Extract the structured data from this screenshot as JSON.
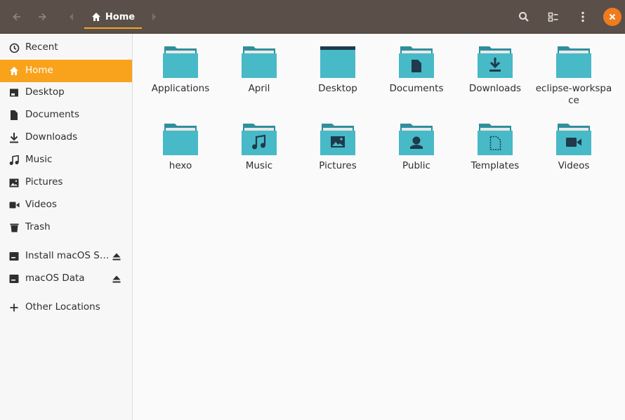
{
  "window": {
    "path_label": "Home"
  },
  "colors": {
    "folder_body": "#48b9c7",
    "folder_tab": "#2f8f9d",
    "glyph": "#1e3a4c",
    "accent": "#f9a31c",
    "header": "#5a4f49",
    "close": "#f07b1d"
  },
  "header": {
    "back_icon": "arrow-left-icon",
    "forward_icon": "arrow-right-icon",
    "search_icon": "search-icon",
    "view_icon": "list-view-icon",
    "menu_icon": "kebab-menu-icon",
    "close_icon": "close-icon"
  },
  "sidebar": {
    "items": [
      {
        "label": "Recent",
        "icon": "clock-icon"
      },
      {
        "label": "Home",
        "icon": "home-icon"
      },
      {
        "label": "Desktop",
        "icon": "desktop-icon"
      },
      {
        "label": "Documents",
        "icon": "document-icon"
      },
      {
        "label": "Downloads",
        "icon": "download-icon"
      },
      {
        "label": "Music",
        "icon": "music-icon"
      },
      {
        "label": "Pictures",
        "icon": "picture-icon"
      },
      {
        "label": "Videos",
        "icon": "video-icon"
      },
      {
        "label": "Trash",
        "icon": "trash-icon"
      }
    ],
    "devices": [
      {
        "label": "Install macOS S…",
        "icon": "drive-icon"
      },
      {
        "label": "macOS Data",
        "icon": "drive-icon"
      }
    ],
    "other": {
      "label": "Other Locations",
      "icon": "plus-icon"
    }
  },
  "files": [
    {
      "name": "Applications",
      "glyph": "none"
    },
    {
      "name": "April",
      "glyph": "none"
    },
    {
      "name": "Desktop",
      "glyph": "desktop"
    },
    {
      "name": "Documents",
      "glyph": "document"
    },
    {
      "name": "Downloads",
      "glyph": "download"
    },
    {
      "name": "eclipse-workspace",
      "glyph": "none"
    },
    {
      "name": "hexo",
      "glyph": "none"
    },
    {
      "name": "Music",
      "glyph": "music"
    },
    {
      "name": "Pictures",
      "glyph": "picture"
    },
    {
      "name": "Public",
      "glyph": "public"
    },
    {
      "name": "Templates",
      "glyph": "template"
    },
    {
      "name": "Videos",
      "glyph": "video"
    }
  ]
}
